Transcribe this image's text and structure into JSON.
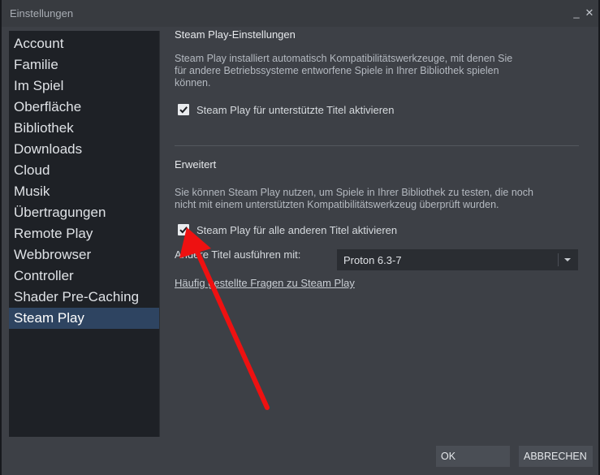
{
  "window": {
    "title": "Einstellungen",
    "minimize_label": "_",
    "close_label": "✕"
  },
  "sidebar": {
    "items": [
      {
        "label": "Account"
      },
      {
        "label": "Familie"
      },
      {
        "label": "Im Spiel"
      },
      {
        "label": "Oberfläche"
      },
      {
        "label": "Bibliothek"
      },
      {
        "label": "Downloads"
      },
      {
        "label": "Cloud"
      },
      {
        "label": "Musik"
      },
      {
        "label": "Übertragungen"
      },
      {
        "label": "Remote Play"
      },
      {
        "label": "Webbrowser"
      },
      {
        "label": "Controller"
      },
      {
        "label": "Shader Pre-Caching"
      },
      {
        "label": "Steam Play",
        "active": true
      }
    ]
  },
  "main": {
    "section1": {
      "title": "Steam Play-Einstellungen",
      "description_lines": [
        "Steam Play installiert automatisch Kompatibilitätswerkzeuge, mit denen Sie",
        "für andere Betriebssysteme entworfene Spiele in Ihrer Bibliothek spielen",
        "können."
      ],
      "checkbox_label": "Steam Play für unterstützte Titel aktivieren",
      "checkbox_checked": true
    },
    "section2": {
      "title": "Erweitert",
      "description_lines": [
        "Sie können Steam Play nutzen, um Spiele in Ihrer Bibliothek zu testen, die noch",
        "nicht mit einem unterstützten Kompatibilitätswerkzeug überprüft wurden."
      ],
      "checkbox_label": "Steam Play für alle anderen Titel aktivieren",
      "checkbox_checked": true,
      "run_with_label": "Andere Titel ausführen mit:",
      "run_with_selected": "Proton 6.3-7",
      "faq_link": "Häufig gestellte Fragen zu Steam Play"
    }
  },
  "footer": {
    "ok_label": "OK",
    "cancel_label": "ABBRECHEN"
  },
  "annotation": {
    "arrow_color": "#ee1111"
  }
}
